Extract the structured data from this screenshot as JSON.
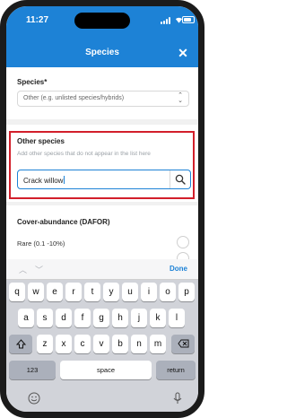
{
  "status_bar": {
    "time": "11:27"
  },
  "nav": {
    "title": "Species"
  },
  "species_field": {
    "label": "Species*",
    "selected": "Other (e.g. unlisted species/hybrids)"
  },
  "other_species": {
    "label": "Other species",
    "hint": "Add other species that do not appear in the list here",
    "value": "Crack willow"
  },
  "cover_abundance": {
    "label": "Cover-abundance (DAFOR)",
    "first_option": "Rare (0.1 -10%)"
  },
  "keyboard": {
    "done_label": "Done",
    "row1": [
      "q",
      "w",
      "e",
      "r",
      "t",
      "y",
      "u",
      "i",
      "o",
      "p"
    ],
    "row2": [
      "a",
      "s",
      "d",
      "f",
      "g",
      "h",
      "j",
      "k",
      "l"
    ],
    "row3": [
      "z",
      "x",
      "c",
      "v",
      "b",
      "n",
      "m"
    ],
    "numbers_label": "123",
    "space_label": "space",
    "return_label": "return"
  },
  "colors": {
    "accent": "#1d82d6",
    "highlight": "#d21f2b"
  }
}
